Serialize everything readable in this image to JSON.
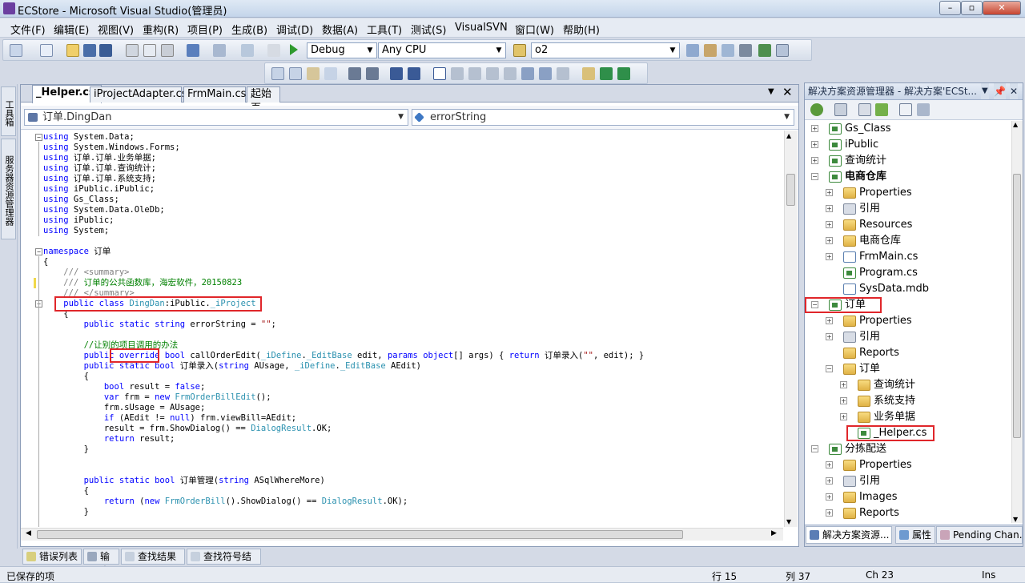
{
  "window": {
    "title": "ECStore - Microsoft Visual Studio(管理员)",
    "minimize": "–",
    "maximize": "▫",
    "close": "✕"
  },
  "menu": [
    "文件(F)",
    "编辑(E)",
    "视图(V)",
    "重构(R)",
    "项目(P)",
    "生成(B)",
    "调试(D)",
    "数据(A)",
    "工具(T)",
    "测试(S)",
    "VisualSVN",
    "窗口(W)",
    "帮助(H)"
  ],
  "toolbar": {
    "config": "Debug",
    "platform": "Any CPU",
    "find": "o2"
  },
  "left_strip": {
    "toolbox": "工具箱",
    "server_explorer": "服务器资源管理器"
  },
  "editor": {
    "tabs": [
      "_Helper.cs",
      "iProjectAdapter.cs",
      "FrmMain.cs",
      "起始页"
    ],
    "class_combo": "订单.DingDan",
    "member_combo": "errorString"
  },
  "code_lines": [
    [
      {
        "t": "using",
        "c": "kw"
      },
      {
        "t": " System.Data;"
      }
    ],
    [
      {
        "t": "using",
        "c": "kw"
      },
      {
        "t": " System.Windows.Forms;"
      }
    ],
    [
      {
        "t": "using",
        "c": "kw"
      },
      {
        "t": " 订单.订单.业务单据;"
      }
    ],
    [
      {
        "t": "using",
        "c": "kw"
      },
      {
        "t": " 订单.订单.查询统计;"
      }
    ],
    [
      {
        "t": "using",
        "c": "kw"
      },
      {
        "t": " 订单.订单.系统支持;"
      }
    ],
    [
      {
        "t": "using",
        "c": "kw"
      },
      {
        "t": " iPublic.iPublic;"
      }
    ],
    [
      {
        "t": "using",
        "c": "kw"
      },
      {
        "t": " Gs_Class;"
      }
    ],
    [
      {
        "t": "using",
        "c": "kw"
      },
      {
        "t": " System.Data.OleDb;"
      }
    ],
    [
      {
        "t": "using",
        "c": "kw"
      },
      {
        "t": " iPublic;"
      }
    ],
    [
      {
        "t": "using",
        "c": "kw"
      },
      {
        "t": " System;"
      }
    ],
    [],
    [
      {
        "t": "namespace",
        "c": "kw"
      },
      {
        "t": " 订单"
      }
    ],
    [
      {
        "t": "{"
      }
    ],
    [
      {
        "t": "    "
      },
      {
        "t": "/// ",
        "c": "gr"
      },
      {
        "t": "<summary>",
        "c": "gr"
      }
    ],
    [
      {
        "t": "    "
      },
      {
        "t": "/// ",
        "c": "gr"
      },
      {
        "t": "订单的公共函数库，海宏软件，20150823",
        "c": "cm"
      }
    ],
    [
      {
        "t": "    "
      },
      {
        "t": "/// ",
        "c": "gr"
      },
      {
        "t": "</summary>",
        "c": "gr"
      }
    ],
    [
      {
        "t": "    "
      },
      {
        "t": "public",
        "c": "kw"
      },
      {
        "t": " "
      },
      {
        "t": "class",
        "c": "kw"
      },
      {
        "t": " "
      },
      {
        "t": "DingDan",
        "c": "ty"
      },
      {
        "t": ":iPublic."
      },
      {
        "t": "_iProject",
        "c": "ty"
      }
    ],
    [
      {
        "t": "    {"
      }
    ],
    [
      {
        "t": "        "
      },
      {
        "t": "public",
        "c": "kw"
      },
      {
        "t": " "
      },
      {
        "t": "static",
        "c": "kw"
      },
      {
        "t": " "
      },
      {
        "t": "string",
        "c": "kw"
      },
      {
        "t": " errorString = "
      },
      {
        "t": "\"\"",
        "c": "st"
      },
      {
        "t": ";"
      }
    ],
    [],
    [
      {
        "t": "        "
      },
      {
        "t": "//让别的项目调用的办法",
        "c": "cm"
      }
    ],
    [
      {
        "t": "        "
      },
      {
        "t": "public",
        "c": "kw"
      },
      {
        "t": " "
      },
      {
        "t": "override",
        "c": "kw"
      },
      {
        "t": " "
      },
      {
        "t": "bool",
        "c": "kw"
      },
      {
        "t": " callOrderEdit("
      },
      {
        "t": "_iDefine",
        "c": "ty"
      },
      {
        "t": "."
      },
      {
        "t": "_EditBase",
        "c": "ty"
      },
      {
        "t": " edit, "
      },
      {
        "t": "params",
        "c": "kw"
      },
      {
        "t": " "
      },
      {
        "t": "object",
        "c": "kw"
      },
      {
        "t": "[] args) { "
      },
      {
        "t": "return",
        "c": "kw"
      },
      {
        "t": " 订单录入("
      },
      {
        "t": "\"\"",
        "c": "st"
      },
      {
        "t": ", edit); }"
      }
    ],
    [
      {
        "t": "        "
      },
      {
        "t": "public",
        "c": "kw"
      },
      {
        "t": " "
      },
      {
        "t": "static",
        "c": "kw"
      },
      {
        "t": " "
      },
      {
        "t": "bool",
        "c": "kw"
      },
      {
        "t": " 订单录入("
      },
      {
        "t": "string",
        "c": "kw"
      },
      {
        "t": " AUsage, "
      },
      {
        "t": "_iDefine",
        "c": "ty"
      },
      {
        "t": "."
      },
      {
        "t": "_EditBase",
        "c": "ty"
      },
      {
        "t": " AEdit)"
      }
    ],
    [
      {
        "t": "        {"
      }
    ],
    [
      {
        "t": "            "
      },
      {
        "t": "bool",
        "c": "kw"
      },
      {
        "t": " result = "
      },
      {
        "t": "false",
        "c": "kw"
      },
      {
        "t": ";"
      }
    ],
    [
      {
        "t": "            "
      },
      {
        "t": "var",
        "c": "kw"
      },
      {
        "t": " frm = "
      },
      {
        "t": "new",
        "c": "kw"
      },
      {
        "t": " "
      },
      {
        "t": "FrmOrderBillEdit",
        "c": "ty"
      },
      {
        "t": "();"
      }
    ],
    [
      {
        "t": "            frm.sUsage = AUsage;"
      }
    ],
    [
      {
        "t": "            "
      },
      {
        "t": "if",
        "c": "kw"
      },
      {
        "t": " (AEdit != "
      },
      {
        "t": "null",
        "c": "kw"
      },
      {
        "t": ") frm.viewBill=AEdit;"
      }
    ],
    [
      {
        "t": "            result = frm.ShowDialog() == "
      },
      {
        "t": "DialogResult",
        "c": "ty"
      },
      {
        "t": ".OK;"
      }
    ],
    [
      {
        "t": "            "
      },
      {
        "t": "return",
        "c": "kw"
      },
      {
        "t": " result;"
      }
    ],
    [
      {
        "t": "        }"
      }
    ],
    [],
    [],
    [
      {
        "t": "        "
      },
      {
        "t": "public",
        "c": "kw"
      },
      {
        "t": " "
      },
      {
        "t": "static",
        "c": "kw"
      },
      {
        "t": " "
      },
      {
        "t": "bool",
        "c": "kw"
      },
      {
        "t": " 订单管理("
      },
      {
        "t": "string",
        "c": "kw"
      },
      {
        "t": " ASqlWhereMore)"
      }
    ],
    [
      {
        "t": "        {"
      }
    ],
    [
      {
        "t": "            "
      },
      {
        "t": "return",
        "c": "kw"
      },
      {
        "t": " ("
      },
      {
        "t": "new",
        "c": "kw"
      },
      {
        "t": " "
      },
      {
        "t": "FrmOrderBill",
        "c": "ty"
      },
      {
        "t": "().ShowDialog() == "
      },
      {
        "t": "DialogResult",
        "c": "ty"
      },
      {
        "t": ".OK);"
      }
    ],
    [
      {
        "t": "        }"
      }
    ]
  ],
  "bottom_tabs": [
    "错误列表",
    "输出",
    "查找结果 1",
    "查找符号结果"
  ],
  "status": {
    "text": "已保存的项",
    "line": "行 15",
    "col": "列 37",
    "ch": "Ch 23",
    "mode": "Ins"
  },
  "solution_explorer": {
    "title": "解决方案资源管理器 - 解决方案'ECSt...",
    "tree": [
      {
        "label": "Gs_Class",
        "icon": "proj",
        "level": 0,
        "exp": "+"
      },
      {
        "label": "iPublic",
        "icon": "proj",
        "level": 0,
        "exp": "+"
      },
      {
        "label": "查询统计",
        "icon": "proj",
        "level": 0,
        "exp": "+"
      },
      {
        "label": "电商仓库",
        "icon": "proj",
        "level": 0,
        "exp": "−",
        "bold": true
      },
      {
        "label": "Properties",
        "icon": "folder",
        "level": 1,
        "exp": "+"
      },
      {
        "label": "引用",
        "icon": "ref",
        "level": 1,
        "exp": "+"
      },
      {
        "label": "Resources",
        "icon": "folder",
        "level": 1,
        "exp": "+"
      },
      {
        "label": "电商仓库",
        "icon": "folder",
        "level": 1,
        "exp": "+"
      },
      {
        "label": "FrmMain.cs",
        "icon": "file",
        "level": 1,
        "exp": "+"
      },
      {
        "label": "Program.cs",
        "icon": "proj",
        "level": 1,
        "exp": ""
      },
      {
        "label": "SysData.mdb",
        "icon": "file",
        "level": 1,
        "exp": ""
      },
      {
        "label": "订单",
        "icon": "proj",
        "level": 0,
        "exp": "−"
      },
      {
        "label": "Properties",
        "icon": "folder",
        "level": 1,
        "exp": "+"
      },
      {
        "label": "引用",
        "icon": "ref",
        "level": 1,
        "exp": "+"
      },
      {
        "label": "Reports",
        "icon": "folder",
        "level": 1,
        "exp": ""
      },
      {
        "label": "订单",
        "icon": "folder",
        "level": 1,
        "exp": "−"
      },
      {
        "label": "查询统计",
        "icon": "folder",
        "level": 2,
        "exp": "+"
      },
      {
        "label": "系统支持",
        "icon": "folder",
        "level": 2,
        "exp": "+"
      },
      {
        "label": "业务单据",
        "icon": "folder",
        "level": 2,
        "exp": "+"
      },
      {
        "label": "_Helper.cs",
        "icon": "proj",
        "level": 2,
        "exp": ""
      },
      {
        "label": "分拣配送",
        "icon": "proj",
        "level": 0,
        "exp": "−"
      },
      {
        "label": "Properties",
        "icon": "folder",
        "level": 1,
        "exp": "+"
      },
      {
        "label": "引用",
        "icon": "ref",
        "level": 1,
        "exp": "+"
      },
      {
        "label": "Images",
        "icon": "folder",
        "level": 1,
        "exp": "+"
      },
      {
        "label": "Reports",
        "icon": "folder",
        "level": 1,
        "exp": "+"
      }
    ],
    "bottom_tabs": [
      "解决方案资源...",
      "属性",
      "Pending Chan..."
    ]
  },
  "colors": {
    "highlight": "#e0262a",
    "keyword": "#0000ff",
    "type": "#2b91af",
    "comment": "#008000"
  }
}
